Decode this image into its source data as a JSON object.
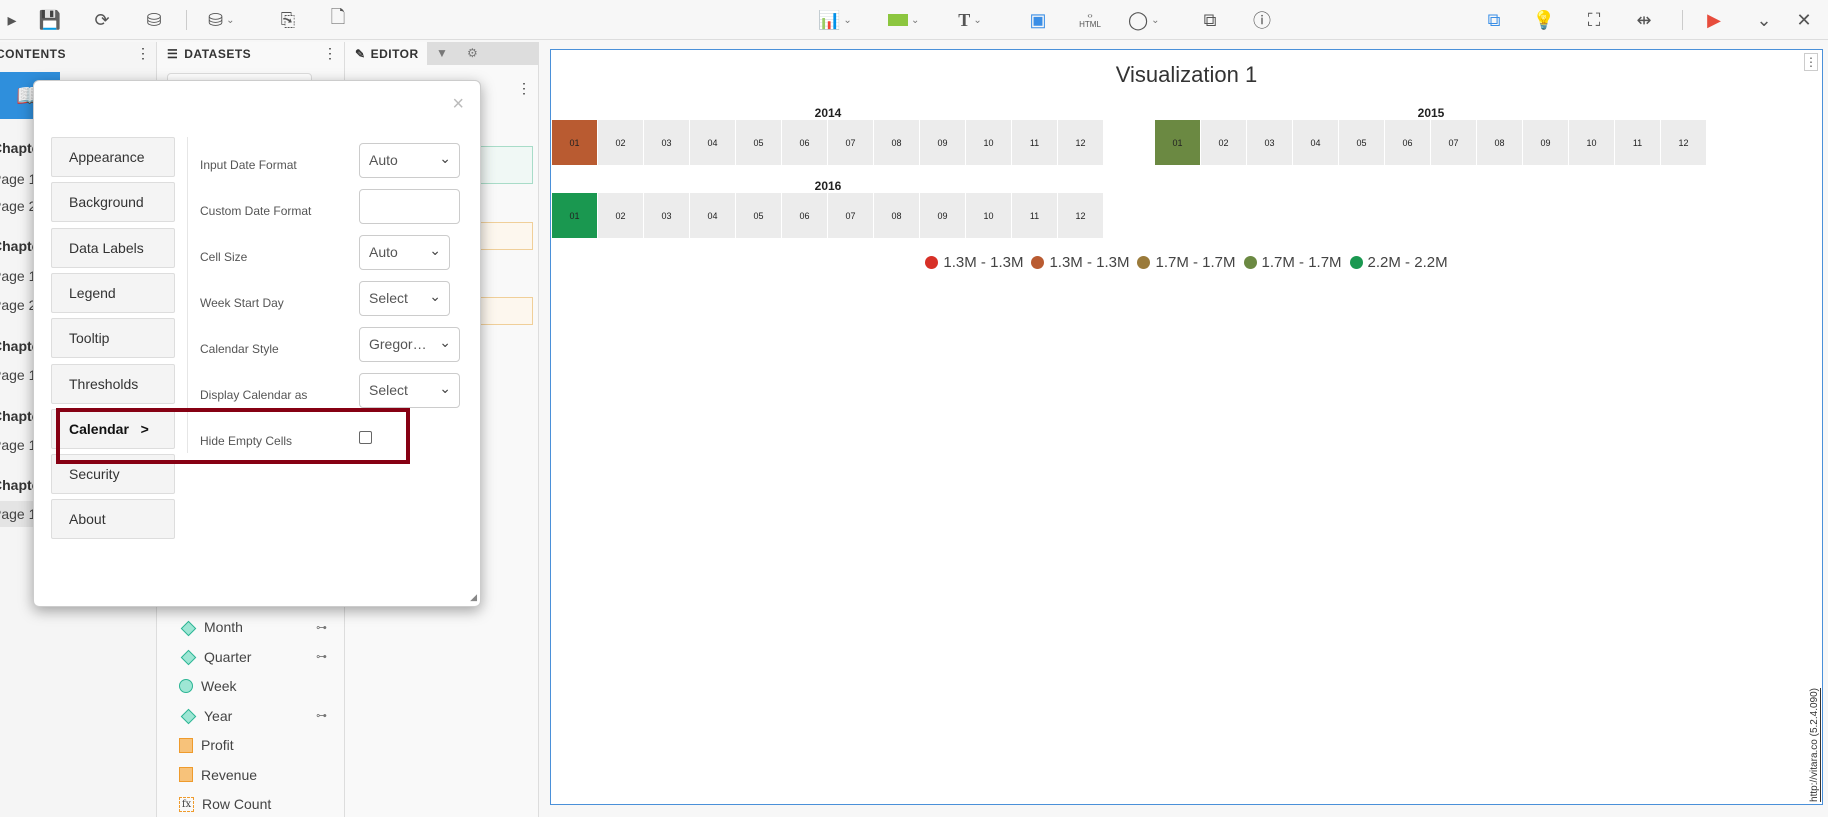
{
  "toolbar": {
    "left": [
      "save-icon",
      "refresh-icon",
      "database-pause-icon",
      "add-dataset-icon",
      "copy-add-icon",
      "new-file-icon"
    ],
    "html_label": "HTML"
  },
  "panels": {
    "contents": "CONTENTS",
    "datasets": "DATASETS",
    "editor": "EDITOR"
  },
  "contents": [
    {
      "label": "Chapter",
      "type": "ch"
    },
    {
      "label": "Page 1"
    },
    {
      "label": "Page 2"
    },
    {
      "label": "Chapter",
      "type": "ch"
    },
    {
      "label": "Page 1"
    },
    {
      "label": "Page 2"
    },
    {
      "label": "Chapter",
      "type": "ch"
    },
    {
      "label": "Page 1"
    },
    {
      "label": "Chapter",
      "type": "ch"
    },
    {
      "label": "Page 1"
    },
    {
      "label": "Chapter",
      "type": "ch"
    },
    {
      "label": "Page 1",
      "selected": true
    }
  ],
  "fields": [
    {
      "label": "Month",
      "icon": "dimension",
      "link": true
    },
    {
      "label": "Quarter",
      "icon": "dimension",
      "link": true
    },
    {
      "label": "Week",
      "icon": "date",
      "link": false
    },
    {
      "label": "Year",
      "icon": "dimension",
      "link": true
    },
    {
      "label": "Profit",
      "icon": "measure"
    },
    {
      "label": "Revenue",
      "icon": "measure"
    },
    {
      "label": "Row Count",
      "icon": "calculated"
    }
  ],
  "dialog": {
    "menu": [
      "Appearance",
      "Background",
      "Data Labels",
      "Legend",
      "Tooltip",
      "Thresholds",
      "Calendar   >",
      "Security",
      "About"
    ],
    "active": "Calendar",
    "settings": [
      {
        "label": "Input Date Format",
        "value": "Auto",
        "type": "select"
      },
      {
        "label": "Custom Date Format",
        "value": "",
        "type": "text"
      },
      {
        "label": "Cell Size",
        "value": "Auto",
        "type": "select"
      },
      {
        "label": "Week Start Day",
        "value": "Select",
        "type": "select"
      },
      {
        "label": "Calendar Style",
        "value": "Gregor…",
        "type": "select"
      },
      {
        "label": "Display Calendar as",
        "value": "Select",
        "type": "select"
      },
      {
        "label": "Hide Empty Cells",
        "value": false,
        "type": "checkbox"
      }
    ]
  },
  "visualization": {
    "title": "Visualization 1",
    "credit": "http://vitara.co (5.2.4.090)"
  },
  "chart_data": {
    "type": "heatmap",
    "title": "Visualization 1",
    "years": [
      {
        "year": "2014",
        "months": [
          "01",
          "02",
          "03",
          "04",
          "05",
          "06",
          "07",
          "08",
          "09",
          "10",
          "11",
          "12"
        ],
        "filled": {
          "01": "#b95b31"
        }
      },
      {
        "year": "2015",
        "months": [
          "01",
          "02",
          "03",
          "04",
          "05",
          "06",
          "07",
          "08",
          "09",
          "10",
          "11",
          "12"
        ],
        "filled": {
          "01": "#6b8942"
        }
      },
      {
        "year": "2016",
        "months": [
          "01",
          "02",
          "03",
          "04",
          "05",
          "06",
          "07",
          "08",
          "09",
          "10",
          "11",
          "12"
        ],
        "filled": {
          "01": "#1a9850"
        }
      }
    ],
    "empty_color": "#ececec",
    "legend": [
      {
        "label": "1.3M - 1.3M",
        "color": "#d73027"
      },
      {
        "label": "1.3M - 1.3M",
        "color": "#b95b31"
      },
      {
        "label": "1.7M - 1.7M",
        "color": "#9a7a3a"
      },
      {
        "label": "1.7M - 1.7M",
        "color": "#6b8942"
      },
      {
        "label": "2.2M - 2.2M",
        "color": "#1a9850"
      }
    ],
    "legend_position": "bottom-center"
  }
}
